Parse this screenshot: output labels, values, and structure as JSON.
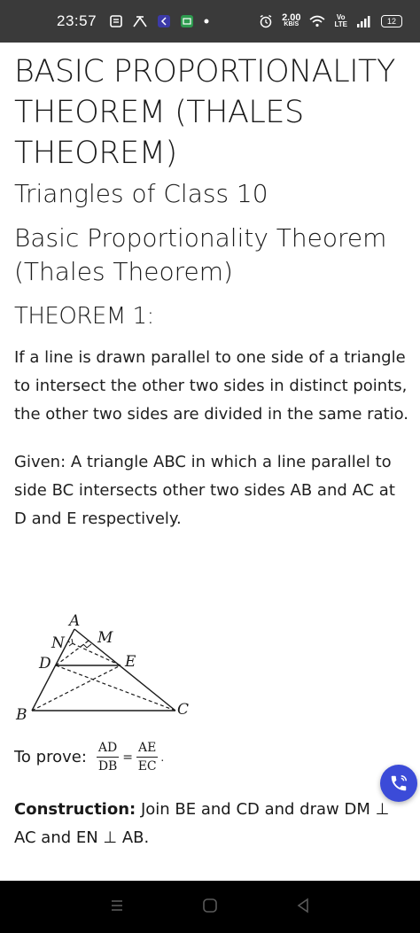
{
  "status_bar": {
    "time": "23:57",
    "speed_value": "2.00",
    "speed_unit": "KB/S",
    "volte_top": "Vo",
    "volte_bottom": "LTE",
    "battery": "12"
  },
  "article": {
    "title": "BASIC PROPORTIONALITY THEOREM (THALES THEOREM)",
    "subtitle": "Triangles of Class 10",
    "section_title": "Basic Proportionality Theorem (Thales Theorem)",
    "theorem_label": "THEOREM 1:",
    "theorem_text": "If a line is drawn parallel to one side of a triangle to intersect the other two sides in distinct points, the other two sides are divided in the same ratio.",
    "given_text": "Given: A triangle ABC in which a line parallel to side BC intersects other two sides AB and AC at D and E respectively.",
    "figure_labels": {
      "A": "A",
      "B": "B",
      "C": "C",
      "D": "D",
      "E": "E",
      "N": "N",
      "M": "M"
    },
    "to_prove_label": "To prove:",
    "fraction_left_num": "AD",
    "fraction_left_den": "DB",
    "equals": "=",
    "fraction_right_num": "AE",
    "fraction_right_den": "EC",
    "to_prove_end": ".",
    "construction_label": "Construction:",
    "construction_text": " Join BE and CD and draw DM ⊥ AC and EN ⊥ AB."
  },
  "colors": {
    "status_bg": "#3a3a3a",
    "fab_bg": "#3b4bd8",
    "nav_bg": "#000000",
    "text": "#1a1a1a"
  },
  "icons": [
    "sim-icon",
    "broadcast-icon",
    "notification-icon",
    "message-icon",
    "alarm-icon",
    "wifi-icon",
    "signal-icon",
    "phone-icon",
    "recent-apps-icon",
    "home-icon",
    "back-icon"
  ]
}
